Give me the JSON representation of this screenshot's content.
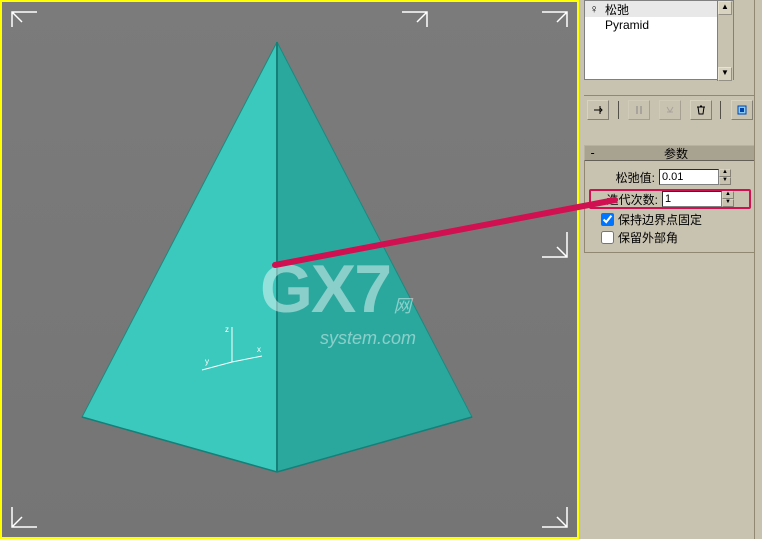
{
  "modifiers": {
    "item0_icon": "♀",
    "item0_label": "松弛",
    "item1_label": "Pyramid"
  },
  "rollout": {
    "toggle": "-",
    "title": "参数"
  },
  "params": {
    "relax_label": "松弛值:",
    "relax_value": "0.01",
    "iter_label": "迭代次数:",
    "iter_value": "1",
    "cb1_label": "保持边界点固定",
    "cb2_label": "保留外部角"
  },
  "watermark": {
    "logo": "GX7",
    "sub": "网",
    "url": "system.com"
  }
}
